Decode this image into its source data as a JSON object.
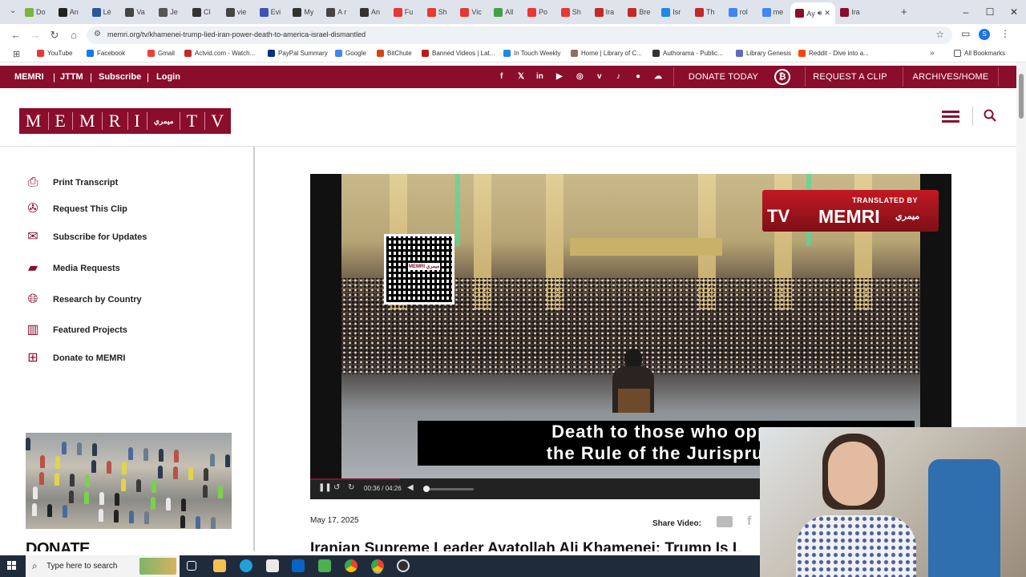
{
  "browser": {
    "tabs": [
      {
        "label": "Do",
        "color": "#7cb342"
      },
      {
        "label": "An",
        "color": "#222222"
      },
      {
        "label": "Lé",
        "color": "#2b579a"
      },
      {
        "label": "Va",
        "color": "#444444"
      },
      {
        "label": "Je",
        "color": "#555555"
      },
      {
        "label": "Cl",
        "color": "#333333"
      },
      {
        "label": "vie",
        "color": "#444444"
      },
      {
        "label": "Evi",
        "color": "#3f51b5"
      },
      {
        "label": "My",
        "color": "#333333"
      },
      {
        "label": "A r",
        "color": "#444444"
      },
      {
        "label": "An",
        "color": "#333333"
      },
      {
        "label": "Fu",
        "color": "#e53935"
      },
      {
        "label": "Sh",
        "color": "#e53935"
      },
      {
        "label": "Vic",
        "color": "#e53935"
      },
      {
        "label": "All",
        "color": "#43a047"
      },
      {
        "label": "Po",
        "color": "#e53935"
      },
      {
        "label": "Sh",
        "color": "#e53935"
      },
      {
        "label": "Ira",
        "color": "#c62828"
      },
      {
        "label": "Bre",
        "color": "#c62828"
      },
      {
        "label": "Isr",
        "color": "#1e88e5"
      },
      {
        "label": "Th",
        "color": "#c62828"
      },
      {
        "label": "rol",
        "color": "#4285f4"
      },
      {
        "label": "me",
        "color": "#4285f4"
      },
      {
        "label": "Ay",
        "color": "#8a0d2c"
      },
      {
        "label": "Ira",
        "color": "#8a0d2c"
      }
    ],
    "active_tab_index": 24,
    "url": "memri.org/tv/khamenei-trump-lied-iran-power-death-to-america-israel-dismantled",
    "bookmarks": [
      {
        "label": "YouTube",
        "color": "#e53935"
      },
      {
        "label": "Facebook",
        "color": "#1877f2"
      },
      {
        "label": "Gmail",
        "color": "#ea4335"
      },
      {
        "label": "Actvid.com - Watch...",
        "color": "#c62828"
      },
      {
        "label": "PayPal Summary",
        "color": "#003087"
      },
      {
        "label": "Google",
        "color": "#4285f4"
      },
      {
        "label": "BitChute",
        "color": "#d84315"
      },
      {
        "label": "Banned Videos | Lat...",
        "color": "#b71c1c"
      },
      {
        "label": "In Touch Weekly",
        "color": "#1e88e5"
      },
      {
        "label": "Home | Library of C...",
        "color": "#8d6e63"
      },
      {
        "label": "Authorama - Public...",
        "color": "#333333"
      },
      {
        "label": "Library Genesis",
        "color": "#5c6bc0"
      },
      {
        "label": "Reddit - Dive into a...",
        "color": "#ff4500"
      }
    ],
    "all_bookmarks_label": "All Bookmarks"
  },
  "topbar": {
    "links": [
      "MEMRI",
      "JTTM",
      "Subscribe",
      "Login"
    ],
    "social_icons": [
      "facebook-icon",
      "x-icon",
      "linkedin-icon",
      "youtube-icon",
      "instagram-icon",
      "vimeo-icon",
      "tiktok-icon",
      "apple-icon",
      "cloud-icon"
    ],
    "donate_label": "DONATE TODAY",
    "request_clip_label": "REQUEST A CLIP",
    "archives_label": "ARCHIVES/HOME",
    "accent": "#8a0d2c"
  },
  "logo": {
    "letters": [
      "M",
      "E",
      "M",
      "R",
      "I",
      "ميمري",
      "T",
      "V"
    ]
  },
  "sidebar": {
    "items": [
      {
        "label": "Print Transcript",
        "icon": "printer-icon"
      },
      {
        "label": "Request This Clip",
        "icon": "film-reel-icon"
      },
      {
        "label": "Subscribe for Updates",
        "icon": "envelope-icon"
      },
      {
        "label": "Media Requests",
        "icon": "chat-bubble-icon"
      },
      {
        "label": "Research by Country",
        "icon": "globe-icon"
      },
      {
        "label": "Featured Projects",
        "icon": "bar-chart-icon"
      },
      {
        "label": "Donate to MEMRI",
        "icon": "gift-icon"
      }
    ],
    "donate_heading": "DONATE"
  },
  "video": {
    "watermark_small": "TRANSLATED BY",
    "watermark_big": "MEMRI",
    "watermark_arabic": "ميمري",
    "watermark_tv": "TV",
    "qr_label": "MEMRI ميمري",
    "subtitle_line1": "Death to those who oppo",
    "subtitle_line2": "the Rule of the Jurisprude",
    "time": "00:36 / 04:26",
    "progress": 0.14
  },
  "article": {
    "date": "May 17, 2025",
    "share_label": "Share Video:",
    "headline": "Iranian Supreme Leader Ayatollah Ali Khamenei: Trump Is L"
  },
  "taskbar": {
    "search_placeholder": "Type here to search",
    "icons": [
      "task-view-icon",
      "file-explorer-icon",
      "edge-icon",
      "store-icon",
      "outlook-icon",
      "app-icon",
      "chrome-icon",
      "chrome-active-icon",
      "obs-icon"
    ]
  }
}
